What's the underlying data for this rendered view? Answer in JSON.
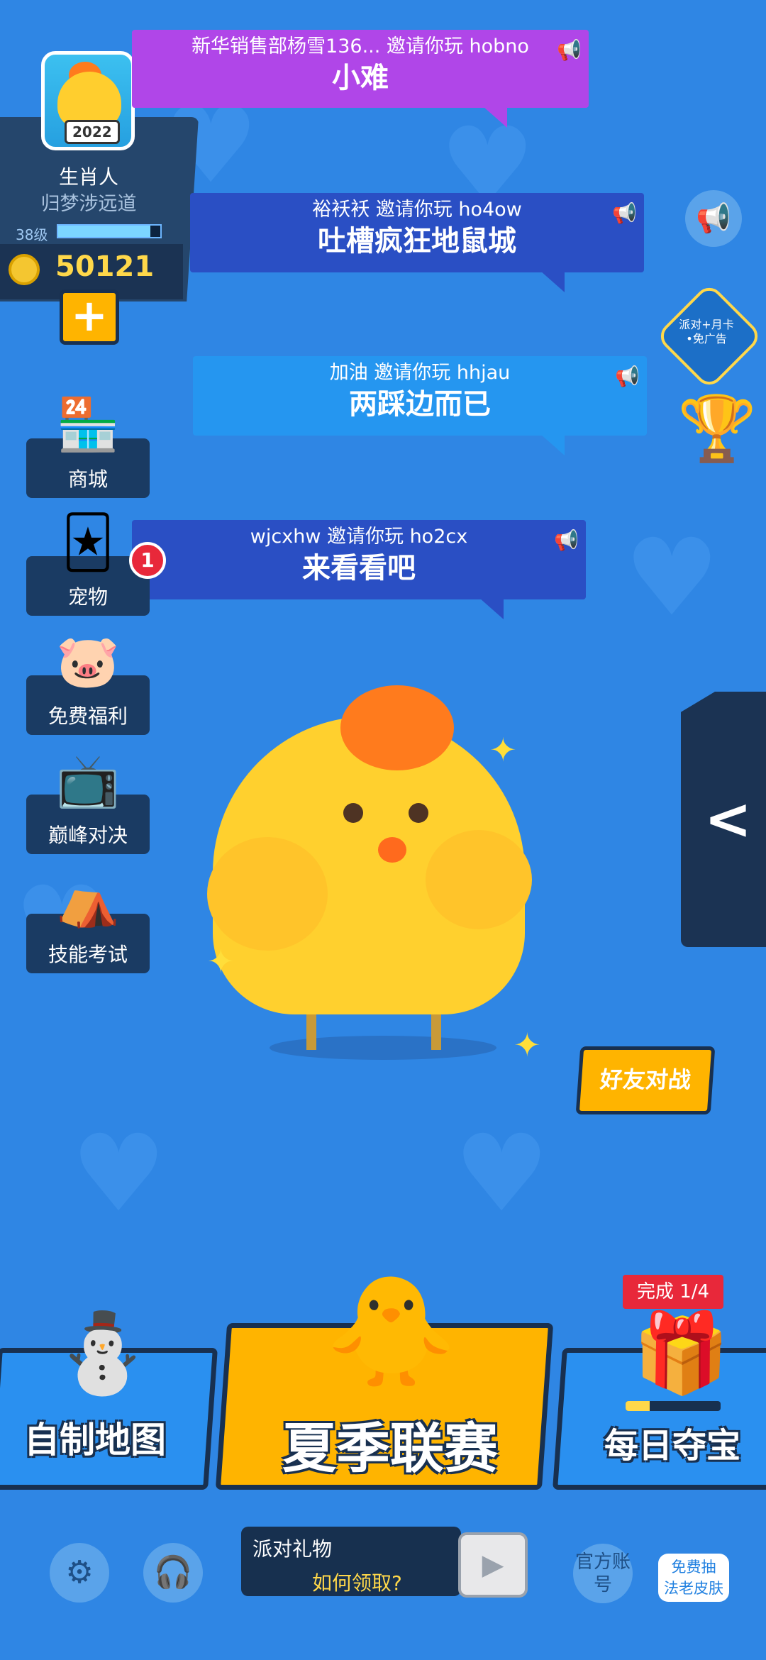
{
  "colors": {
    "background": "#2f86e4",
    "accent_orange": "#ffb400",
    "badge_red": "#e8283a",
    "navy": "#183050"
  },
  "profile": {
    "name": "生肖人",
    "subtitle": "归梦涉远道",
    "level": "38级",
    "level_progress": 0.9,
    "coins": "50121",
    "avatar_text": "2022",
    "add_icon": "plus-icon"
  },
  "banners": [
    {
      "top": "新华销售部杨雪136... 邀请你玩 hobno",
      "main": "小难",
      "color": "#b046e8"
    },
    {
      "top": "裕袄袄 邀请你玩 ho4ow",
      "main": "吐槽疯狂地鼠城",
      "color": "#2a4fc4"
    },
    {
      "top": "加油 邀请你玩 hhjau",
      "main": "两踩边而已",
      "color": "#2596f0"
    },
    {
      "top": "wjcxhw 邀请你玩 ho2cx",
      "main": "来看看吧",
      "color": "#2a4fc4"
    }
  ],
  "menu": [
    {
      "label": "商城",
      "icon": "shop-icon",
      "glyph": "🏪"
    },
    {
      "label": "宠物",
      "icon": "pet-cards-icon",
      "glyph": "🃏"
    },
    {
      "label": "免费福利",
      "icon": "piggy-bank-icon",
      "glyph": "🐷"
    },
    {
      "label": "巅峰对决",
      "icon": "tv-icon",
      "glyph": "📺"
    },
    {
      "label": "技能考试",
      "icon": "tent-icon",
      "glyph": "⛺"
    }
  ],
  "pet_badge": "1",
  "right": {
    "announce_icon": "megaphone-icon",
    "ad_badge": "派对+月卡\n•免广告",
    "trophy_icon": "trophy-icon",
    "friend_battle": "好友对战",
    "panel_arrow": "chevron-left-icon"
  },
  "modes": {
    "left": "自制地图",
    "center": "夏季联赛",
    "right": "每日夺宝",
    "complete": "完成 1/4",
    "treasure_progress": 0.25
  },
  "footer": {
    "settings_icon": "gear-icon",
    "support_icon": "headset-icon",
    "gift_title": "派对礼物",
    "gift_link": "如何领取?",
    "video_icon": "video-icon",
    "official": "官方账号",
    "free_skin_1": "免费抽",
    "free_skin_2": "法老皮肤"
  }
}
